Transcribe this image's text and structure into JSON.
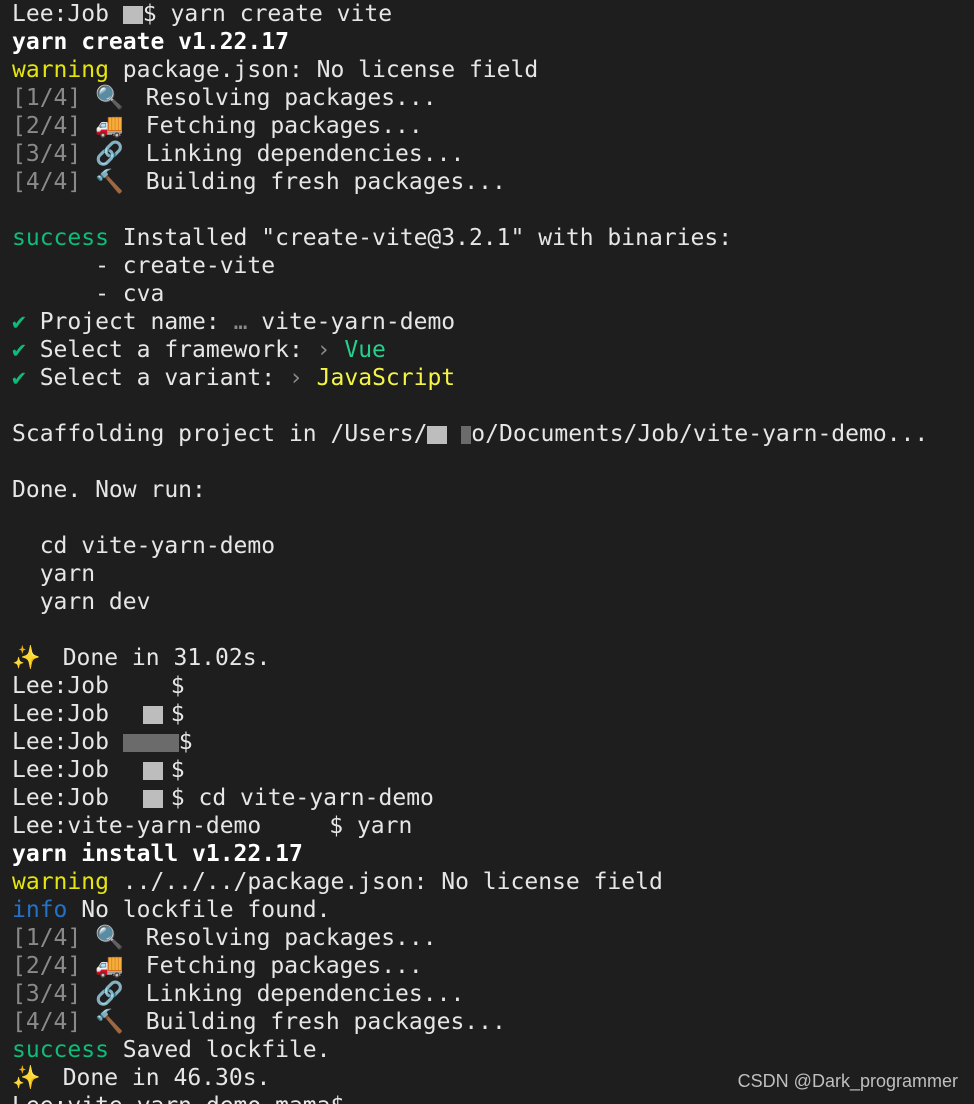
{
  "terminal": {
    "prompt_user": "Lee:Job",
    "lines": {
      "l1_cmd": "$ yarn create vite",
      "l2": "yarn create v1.22.17",
      "l3_warn": "warning",
      "l3_text": " package.json: No license field",
      "l4_step": "[1/4]",
      "l4_text": "  Resolving packages...",
      "l5_step": "[2/4]",
      "l5_text": "  Fetching packages...",
      "l6_step": "[3/4]",
      "l6_text": "  Linking dependencies...",
      "l7_step": "[4/4]",
      "l7_text": "  Building fresh packages...",
      "l9_success": "success",
      "l9_text": " Installed \"create-vite@3.2.1\" with binaries:",
      "l10": "      - create-vite",
      "l11": "      - cva",
      "l12_check": "✔",
      "l12_text": " Project name: ",
      "l12_ellipsis": "…",
      "l12_value": " vite-yarn-demo",
      "l13_check": "✔",
      "l13_text": " Select a framework: ",
      "l13_chev": "›",
      "l13_value": " Vue",
      "l14_check": "✔",
      "l14_text": " Select a variant: ",
      "l14_chev": "›",
      "l14_value": " JavaScript",
      "l16_prefix": "Scaffolding project in /Users/",
      "l16_suffix": "o/Documents/Job/vite-yarn-demo...",
      "l18": "Done. Now run:",
      "l20": "  cd vite-yarn-demo",
      "l21": "  yarn",
      "l22": "  yarn dev",
      "l24_text": "  Done in 31.02s.",
      "l25": "$",
      "l26": "$",
      "l27": "$",
      "l28": "$",
      "l29_cmd": "$ cd vite-yarn-demo",
      "l30_user": "Lee:vite-yarn-demo",
      "l30_cmd": "$ yarn",
      "l31": "yarn install v1.22.17",
      "l32_warn": "warning",
      "l32_text": " ../../../package.json: No license field",
      "l33_info": "info",
      "l33_text": " No lockfile found.",
      "l34_step": "[1/4]",
      "l34_text": "  Resolving packages...",
      "l35_step": "[2/4]",
      "l35_text": "  Fetching packages...",
      "l36_step": "[3/4]",
      "l36_text": "  Linking dependencies...",
      "l37_step": "[4/4]",
      "l37_text": "  Building fresh packages...",
      "l38_success": "success",
      "l38_text": " Saved lockfile.",
      "l39_text": "  Done in 46.30s.",
      "l40_partial": "Lee:vite-yarn-demo mama$"
    },
    "emoji": {
      "resolve": "🔍",
      "fetch": "🚚",
      "link": "🔗",
      "build": "🔨",
      "sparkle": "✨"
    }
  },
  "watermark": "CSDN @Dark_programmer",
  "colors": {
    "background": "#1e1e1e",
    "warning": "#e5e510",
    "success": "#0dbc79",
    "info": "#2472c8",
    "vue": "#23d18b",
    "javascript": "#f5f543"
  }
}
